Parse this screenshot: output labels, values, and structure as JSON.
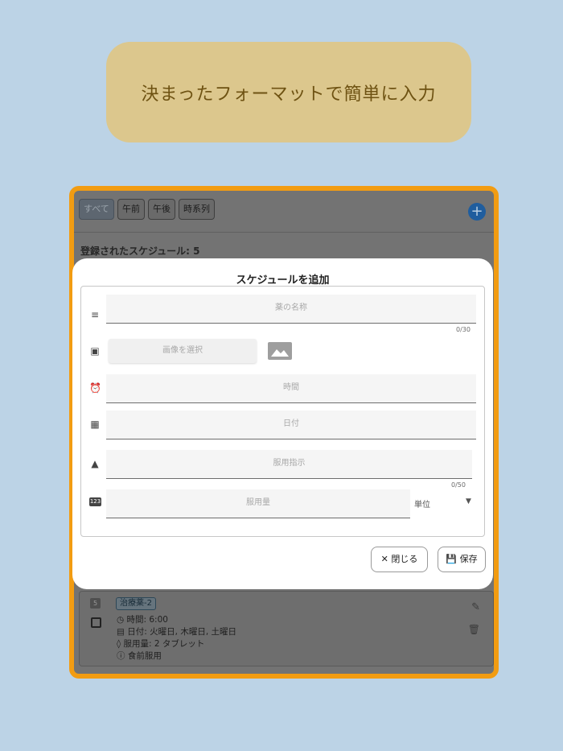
{
  "banner": {
    "text": "決まったフォーマットで簡単に入力"
  },
  "app": {
    "filters": [
      "すべて",
      "午前",
      "午後",
      "時系列"
    ],
    "add_icon": "plus-circle-icon",
    "registered_count_label": "登録されたスケジュール: 5"
  },
  "schedule_card": {
    "number": "5",
    "name": "治療薬-2",
    "time": "時間: 6:00",
    "date": "日付: 火曜日, 木曜日, 土曜日",
    "dosage": "服用量: 2 タブレット",
    "instruction": "食前服用"
  },
  "modal": {
    "title": "スケジュールを追加",
    "name_placeholder": "薬の名称",
    "name_counter": "0/30",
    "image_button": "画像を選択",
    "time_placeholder": "時間",
    "date_placeholder": "日付",
    "instruction_placeholder": "服用指示",
    "instruction_counter": "0/50",
    "dosage_placeholder": "服用量",
    "unit_label": "単位",
    "close_button": "閉じる",
    "save_button": "保存"
  },
  "colors": {
    "background": "#bcd3e6",
    "banner": "#dcc78d",
    "frame_border": "#f29c12",
    "accent_blue": "#1f5d9e"
  }
}
